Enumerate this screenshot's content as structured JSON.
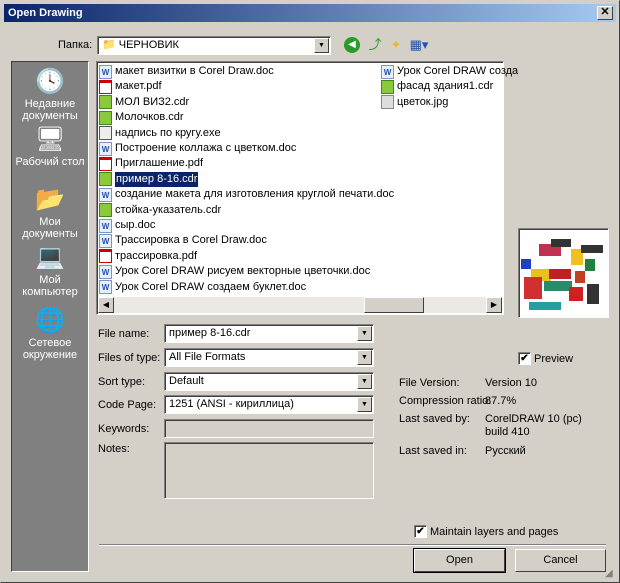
{
  "window": {
    "title": "Open Drawing",
    "close": "✕"
  },
  "folder": {
    "label": "Папка:",
    "value": "ЧЕРНОВИК"
  },
  "toolbar": {
    "back": "back-icon",
    "up": "up-folder-icon",
    "new_folder": "new-folder-icon",
    "view": "view-menu-icon"
  },
  "places": [
    {
      "label": "Недавние документы"
    },
    {
      "label": "Рабочий стол"
    },
    {
      "label": "Мои документы"
    },
    {
      "label": "Мой компьютер"
    },
    {
      "label": "Сетевое окружение"
    }
  ],
  "files": [
    {
      "name": "макет визитки в Corel Draw.doc",
      "type": "doc"
    },
    {
      "name": "макет.pdf",
      "type": "pdf"
    },
    {
      "name": "МОЛ ВИЗ2.cdr",
      "type": "cdr"
    },
    {
      "name": "Молочков.cdr",
      "type": "cdr"
    },
    {
      "name": "надпись по кругу.exe",
      "type": "exe"
    },
    {
      "name": "Построение коллажа с цветком.doc",
      "type": "doc"
    },
    {
      "name": "Приглашение.pdf",
      "type": "pdf"
    },
    {
      "name": "пример 8-16.cdr",
      "type": "cdr",
      "selected": true
    },
    {
      "name": "создание макета для изготовления круглой печати.doc",
      "type": "doc"
    },
    {
      "name": "стойка-указатель.cdr",
      "type": "cdr"
    },
    {
      "name": "сыр.doc",
      "type": "doc"
    },
    {
      "name": "Трассировка в Corel Draw.doc",
      "type": "doc"
    },
    {
      "name": "трассировка.pdf",
      "type": "pdf"
    },
    {
      "name": "Урок Corel DRAW рисуем векторные цветочки.doc",
      "type": "doc"
    },
    {
      "name": "Урок Corel DRAW создаем буклет.doc",
      "type": "doc"
    },
    {
      "name": "Урок Corel DRAW созда",
      "type": "doc"
    },
    {
      "name": "фасад здания1.cdr",
      "type": "cdr"
    },
    {
      "name": "цветок.jpg",
      "type": "jpg"
    }
  ],
  "form": {
    "file_name": {
      "label": "File name:",
      "value": "пример 8-16.cdr"
    },
    "file_type": {
      "label": "Files of type:",
      "value": "All File Formats"
    },
    "sort_type": {
      "label": "Sort type:",
      "value": "Default"
    },
    "code_page": {
      "label": "Code Page:",
      "value": "1251  (ANSI - кириллица)"
    },
    "keywords": {
      "label": "Keywords:",
      "value": ""
    },
    "notes": {
      "label": "Notes:",
      "value": ""
    }
  },
  "preview": {
    "label": "Preview",
    "checked": true
  },
  "info": [
    {
      "label": "File Version:",
      "value": "Version 10"
    },
    {
      "label": "Compression ratio:",
      "value": "87.7%"
    },
    {
      "label": "Last saved by:",
      "value": "CorelDRAW 10 (pc)",
      "value2": "build 410"
    },
    {
      "label": "Last saved in:",
      "value": "Русский"
    }
  ],
  "maintain_layers": {
    "label": "Maintain layers and pages",
    "checked": true
  },
  "buttons": {
    "open": "Open",
    "cancel": "Cancel"
  },
  "check_mark": "✔"
}
